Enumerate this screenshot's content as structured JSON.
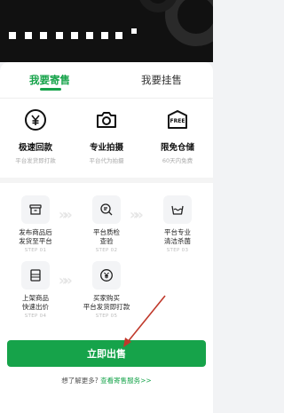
{
  "tabs": [
    {
      "label": "我要寄售"
    },
    {
      "label": "我要挂售"
    }
  ],
  "features": [
    {
      "icon": "yen-coin-icon",
      "title": "极速回款",
      "subtitle": "平台发货即打款"
    },
    {
      "icon": "camera-icon",
      "title": "专业拍摄",
      "subtitle": "平台代为拍摄"
    },
    {
      "icon": "free-badge-icon",
      "badge": "FREE",
      "title": "限免仓储",
      "subtitle": "60天内免费"
    }
  ],
  "steps": [
    {
      "icon": "box-icon",
      "line1": "发布商品后",
      "line2": "发货至平台",
      "step": "STEP 01"
    },
    {
      "icon": "magnifier-icon",
      "line1": "平台质检",
      "line2": "查验",
      "step": "STEP 02"
    },
    {
      "icon": "wash-icon",
      "line1": "平台专业",
      "line2": "清洁杀菌",
      "step": "STEP 03"
    },
    {
      "icon": "shelf-icon",
      "line1": "上架商品",
      "line2": "快速出价",
      "step": "STEP 04"
    },
    {
      "icon": "yen-coin-icon",
      "line1": "买家购买",
      "line2": "平台发货即打款",
      "step": "STEP 05"
    }
  ],
  "cta": {
    "label": "立即出售"
  },
  "footer": {
    "text": "想了解更多?",
    "link": "查看寄售服务>>"
  },
  "colors": {
    "accent": "#16a34a",
    "banner": "#111111",
    "annotation_arrow": "#c0392b"
  }
}
